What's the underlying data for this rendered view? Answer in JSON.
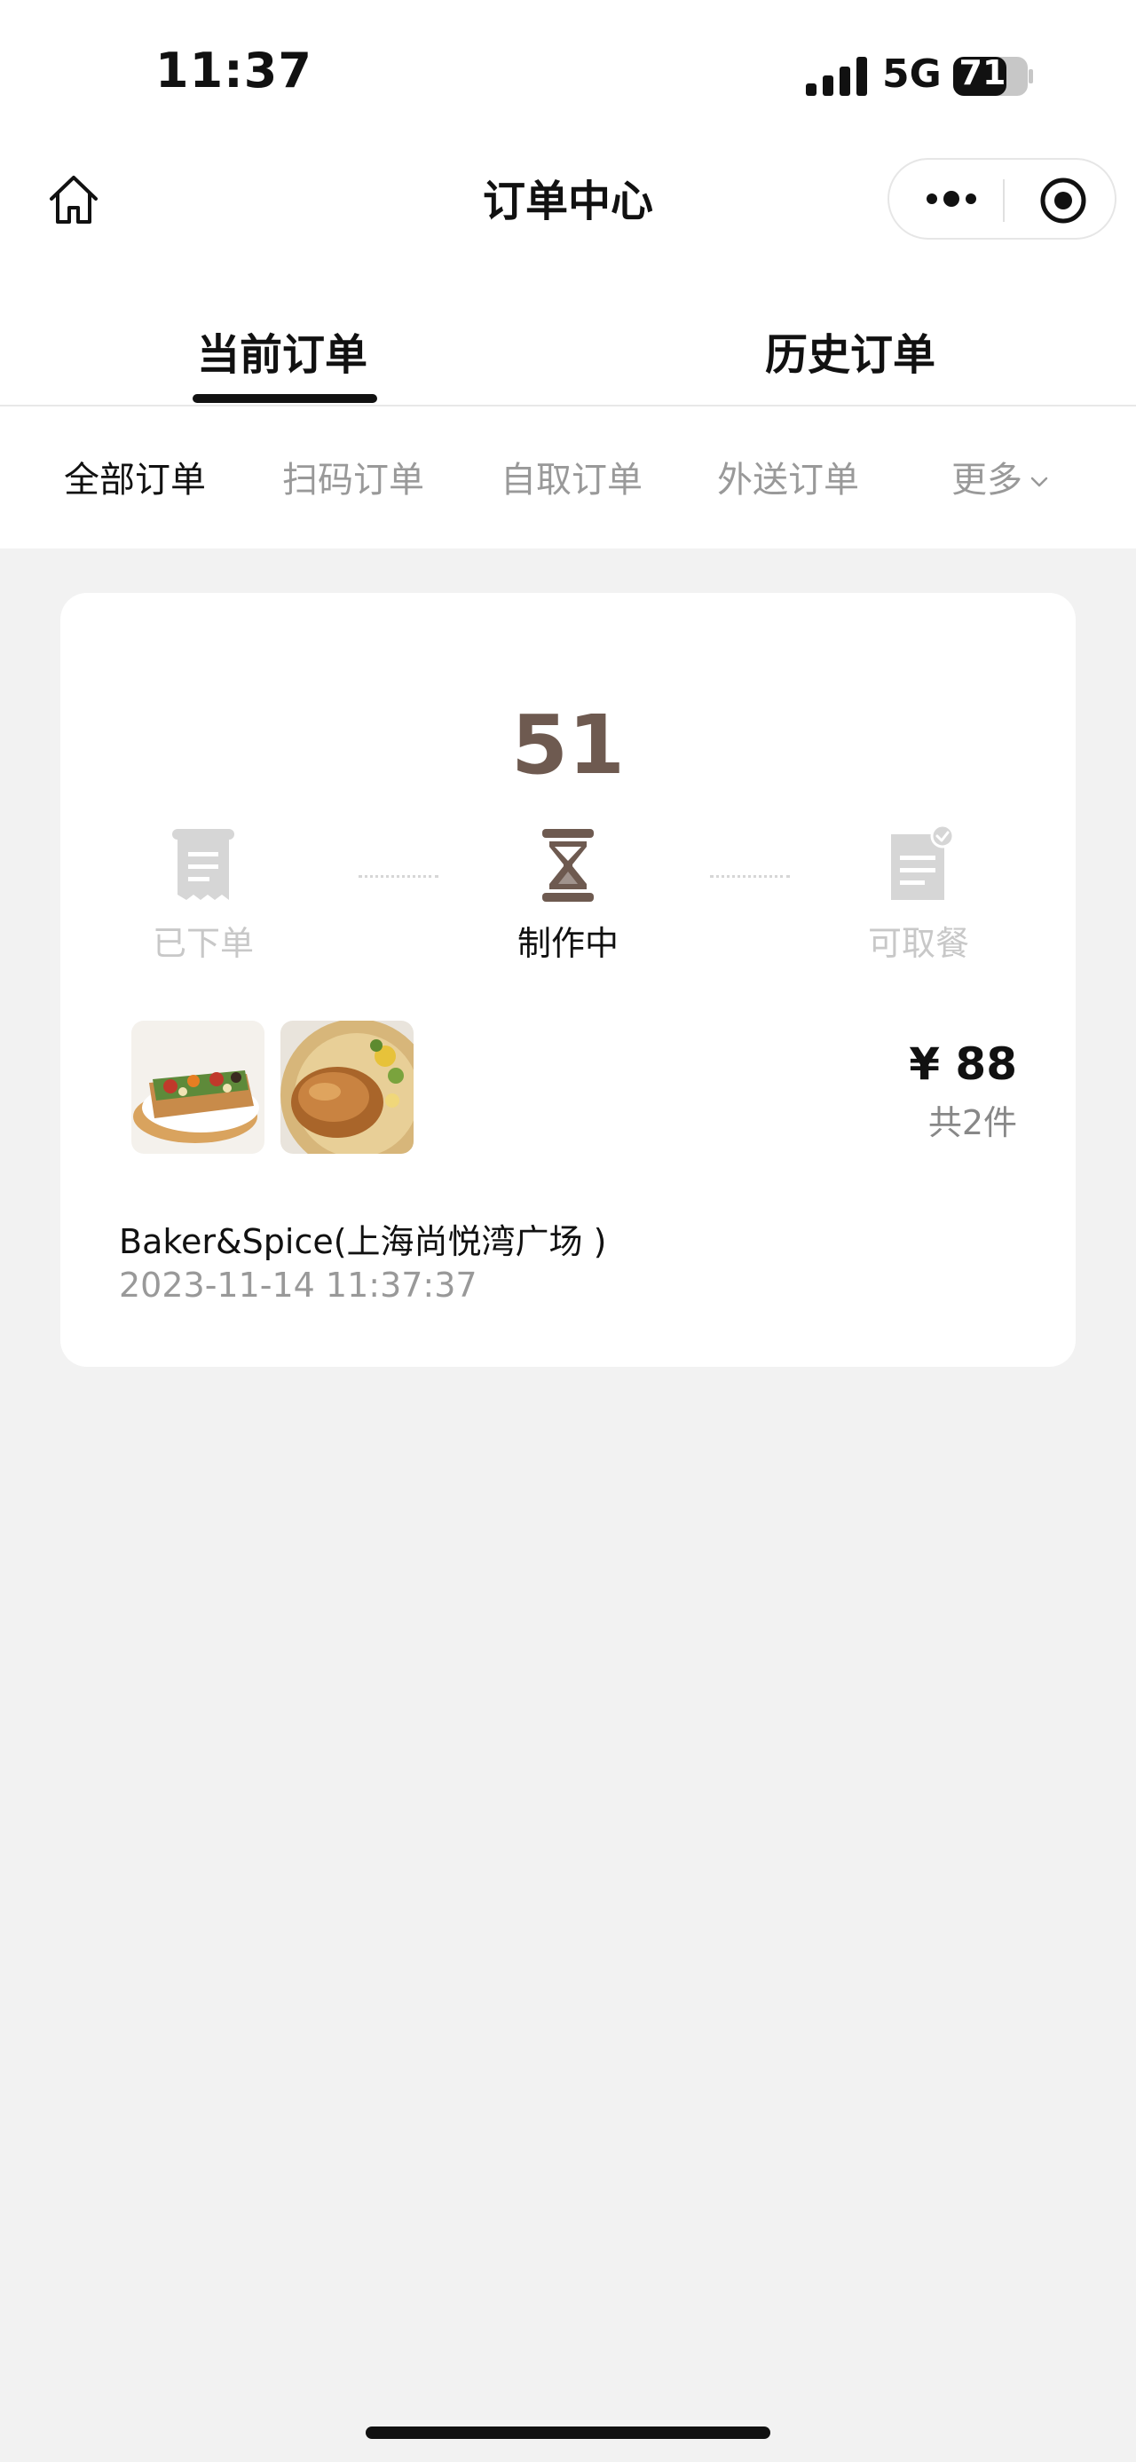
{
  "status_bar": {
    "time": "11:37",
    "network": "5G",
    "battery": "71"
  },
  "nav": {
    "title": "订单中心"
  },
  "main_tabs": [
    {
      "label": "当前订单",
      "selected": true
    },
    {
      "label": "历史订单",
      "selected": false
    }
  ],
  "sub_tabs": [
    {
      "label": "全部订单",
      "selected": true
    },
    {
      "label": "扫码订单",
      "selected": false
    },
    {
      "label": "自取订单",
      "selected": false
    },
    {
      "label": "外送订单",
      "selected": false
    },
    {
      "label": "更多",
      "selected": false
    }
  ],
  "order": {
    "pickup_number": "51",
    "steps": [
      {
        "label": "已下单",
        "icon": "receipt-icon",
        "active": false
      },
      {
        "label": "制作中",
        "icon": "hourglass-icon",
        "active": true
      },
      {
        "label": "可取餐",
        "icon": "document-check-icon",
        "active": false
      }
    ],
    "price": "¥ 88",
    "item_count": "共2件",
    "store_name": "Baker&Spice(上海尚悦湾广场 )",
    "time": "2023-11-14 11:37:37"
  },
  "colors": {
    "accent_brown": "#6e5a50",
    "page_bg": "#f2f2f2",
    "inactive_gray": "#c8c8c8"
  }
}
